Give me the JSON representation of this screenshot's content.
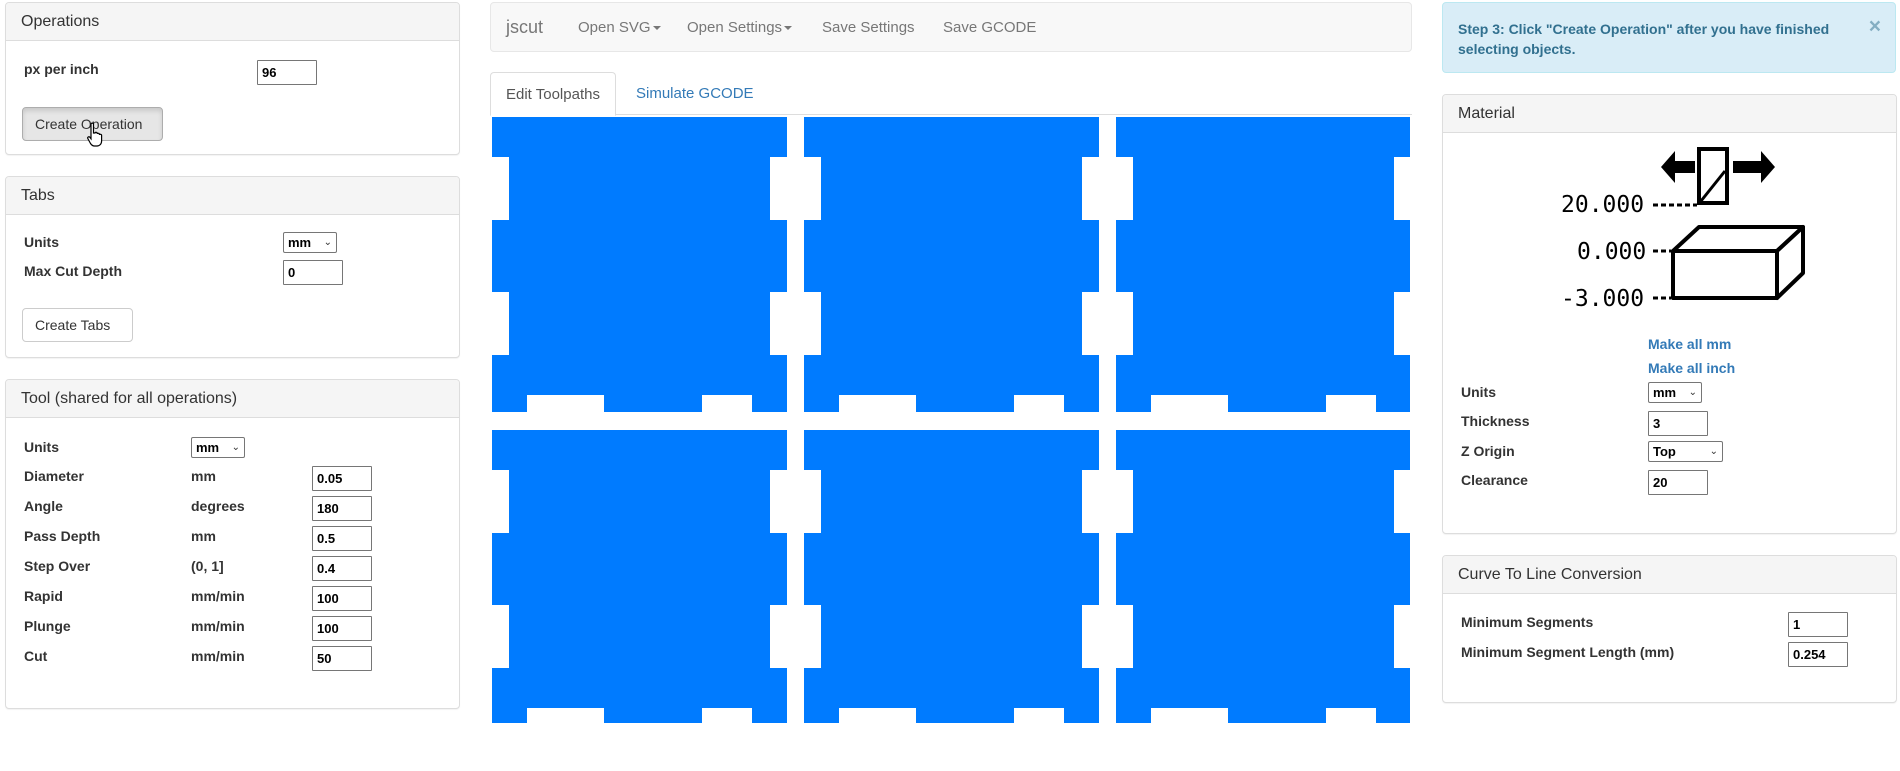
{
  "operations": {
    "title": "Operations",
    "px_per_inch_label": "px per inch",
    "px_per_inch_value": "96",
    "create_operation": "Create Operation"
  },
  "tabs_panel": {
    "title": "Tabs",
    "units_label": "Units",
    "units_value": "mm",
    "max_cut_depth_label": "Max Cut Depth",
    "max_cut_depth_value": "0",
    "create_tabs": "Create Tabs"
  },
  "tool": {
    "title": "Tool (shared for all operations)",
    "units_label": "Units",
    "units_value": "mm",
    "rows": [
      {
        "label": "Diameter",
        "unit": "mm",
        "value": "0.05"
      },
      {
        "label": "Angle",
        "unit": "degrees",
        "value": "180"
      },
      {
        "label": "Pass Depth",
        "unit": "mm",
        "value": "0.5"
      },
      {
        "label": "Step Over",
        "unit": "(0, 1]",
        "value": "0.4"
      },
      {
        "label": "Rapid",
        "unit": "mm/min",
        "value": "100"
      },
      {
        "label": "Plunge",
        "unit": "mm/min",
        "value": "100"
      },
      {
        "label": "Cut",
        "unit": "mm/min",
        "value": "50"
      }
    ]
  },
  "navbar": {
    "brand": "jscut",
    "open_svg": "Open SVG",
    "open_settings": "Open Settings",
    "save_settings": "Save Settings",
    "save_gcode": "Save GCODE"
  },
  "main_tabs": {
    "edit_toolpaths": "Edit Toolpaths",
    "simulate_gcode": "Simulate GCODE"
  },
  "canvas": {
    "shape_color": "#007bff",
    "shape_count": 6
  },
  "alert": {
    "message": "Step 3: Click \"Create Operation\" after you have finished selecting objects.",
    "close": "×"
  },
  "material": {
    "title": "Material",
    "diagram": {
      "clearance_value": "20.000",
      "top_value": "0.000",
      "bottom_value": "-3.000"
    },
    "make_all_mm": "Make all mm",
    "make_all_inch": "Make all inch",
    "units_label": "Units",
    "units_value": "mm",
    "thickness_label": "Thickness",
    "thickness_value": "3",
    "z_origin_label": "Z Origin",
    "z_origin_value": "Top",
    "clearance_label": "Clearance",
    "clearance_value": "20"
  },
  "curve": {
    "title": "Curve To Line Conversion",
    "min_segments_label": "Minimum Segments",
    "min_segments_value": "1",
    "min_segment_length_label": "Minimum Segment Length (mm)",
    "min_segment_length_value": "0.254"
  }
}
